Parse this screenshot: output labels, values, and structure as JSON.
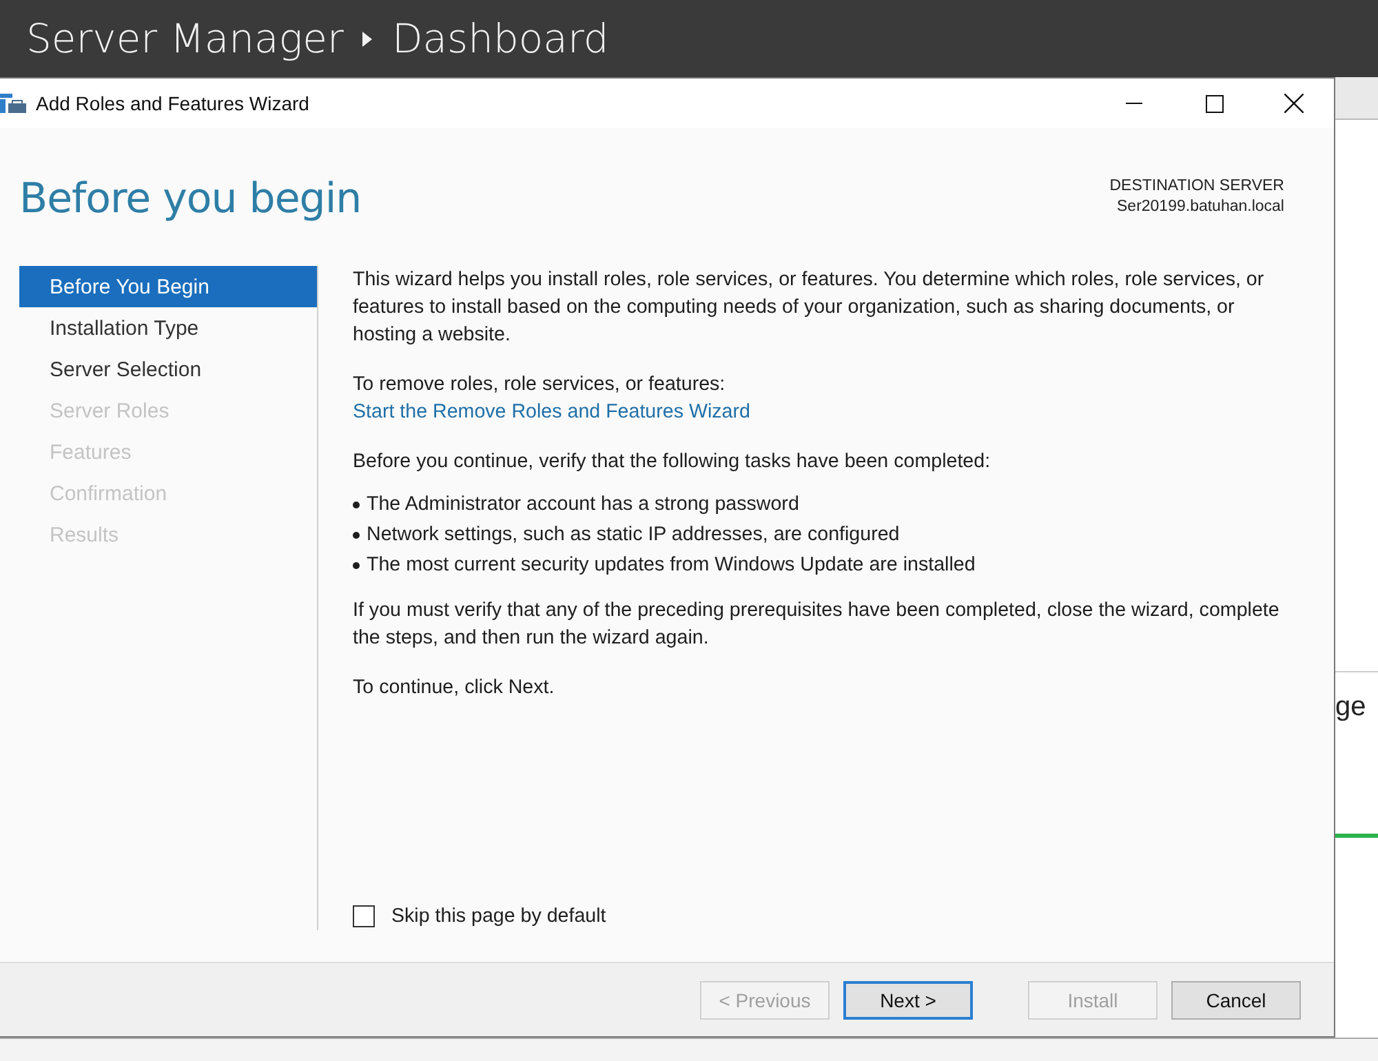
{
  "background": {
    "title": "Server Manager",
    "page": "Dashboard",
    "side_text": "ge"
  },
  "window": {
    "title": "Add Roles and Features Wizard"
  },
  "page_title": "Before you begin",
  "destination": {
    "label": "DESTINATION SERVER",
    "server": "Ser20199.batuhan.local"
  },
  "steps": [
    {
      "label": "Before You Begin",
      "selected": true,
      "disabled": false
    },
    {
      "label": "Installation Type",
      "selected": false,
      "disabled": false
    },
    {
      "label": "Server Selection",
      "selected": false,
      "disabled": false
    },
    {
      "label": "Server Roles",
      "selected": false,
      "disabled": true
    },
    {
      "label": "Features",
      "selected": false,
      "disabled": true
    },
    {
      "label": "Confirmation",
      "selected": false,
      "disabled": true
    },
    {
      "label": "Results",
      "selected": false,
      "disabled": true
    }
  ],
  "content": {
    "intro": "This wizard helps you install roles, role services, or features. You determine which roles, role services, or features to install based on the computing needs of your organization, such as sharing documents, or hosting a website.",
    "remove_label": "To remove roles, role services, or features:",
    "remove_link": "Start the Remove Roles and Features Wizard",
    "verify_label": "Before you continue, verify that the following tasks have been completed:",
    "tasks": [
      "The Administrator account has a strong password",
      "Network settings, such as static IP addresses, are configured",
      "The most current security updates from Windows Update are installed"
    ],
    "note": "If you must verify that any of the preceding prerequisites have been completed, close the wizard, complete the steps, and then run the wizard again.",
    "continue": "To continue, click Next."
  },
  "skip_checkbox": {
    "label": "Skip this page by default",
    "checked": false
  },
  "buttons": [
    {
      "label": "< Previous",
      "disabled": true,
      "default": false
    },
    {
      "label": "Next >",
      "disabled": false,
      "default": true
    },
    {
      "label": "Install",
      "disabled": true,
      "default": false
    },
    {
      "label": "Cancel",
      "disabled": false,
      "default": false
    }
  ]
}
